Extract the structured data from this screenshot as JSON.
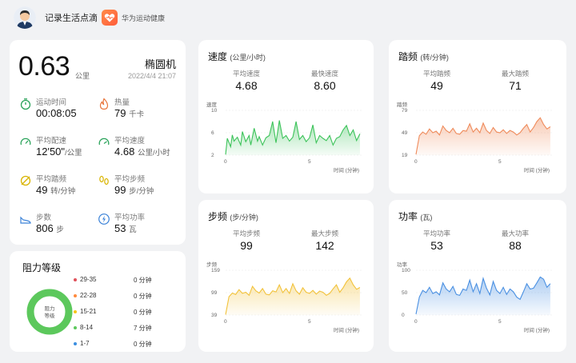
{
  "header": {
    "title": "记录生活点滴",
    "app_name": "华为运动健康"
  },
  "summary": {
    "distance": "0.63",
    "distance_unit": "公里",
    "mode": "椭圆机",
    "datetime": "2022/4/4 21:07",
    "metrics": [
      {
        "label": "运动时间",
        "value": "00:08:05",
        "unit": "",
        "icon": "stopwatch-icon",
        "color": "#2aa35a"
      },
      {
        "label": "热量",
        "value": "79",
        "unit": "千卡",
        "icon": "flame-icon",
        "color": "#e8743b"
      },
      {
        "label": "平均配速",
        "value": "12'50\"",
        "unit": "/公里",
        "icon": "pace-gauge-icon",
        "color": "#2aa35a"
      },
      {
        "label": "平均速度",
        "value": "4.68",
        "unit": "公里/小时",
        "icon": "speed-gauge-icon",
        "color": "#2aa35a"
      },
      {
        "label": "平均踏频",
        "value": "49",
        "unit": "转/分钟",
        "icon": "cadence-icon",
        "color": "#d9b400"
      },
      {
        "label": "平均步频",
        "value": "99",
        "unit": "步/分钟",
        "icon": "footprints-icon",
        "color": "#d9b400"
      },
      {
        "label": "步数",
        "value": "806",
        "unit": "步",
        "icon": "shoe-icon",
        "color": "#3b82d8"
      },
      {
        "label": "平均功率",
        "value": "53",
        "unit": "瓦",
        "icon": "power-bolt-icon",
        "color": "#3b82d8"
      }
    ]
  },
  "resistance": {
    "title": "阻力等级",
    "center_label_1": "阻力",
    "center_label_2": "等级",
    "rows": [
      {
        "range": "29-35",
        "duration": "0 分钟",
        "color": "#e0505a"
      },
      {
        "range": "22-28",
        "duration": "0 分钟",
        "color": "#ff8a3d"
      },
      {
        "range": "15-21",
        "duration": "0 分钟",
        "color": "#f5c518"
      },
      {
        "range": "8-14",
        "duration": "7 分钟",
        "color": "#5cc85c"
      },
      {
        "range": "1-7",
        "duration": "0 分钟",
        "color": "#3b8fe0"
      }
    ]
  },
  "speed_card": {
    "title": "速度",
    "unit": "(公里/小时)",
    "stat1_label": "平均速度",
    "stat1_value": "4.68",
    "stat2_label": "最快速度",
    "stat2_value": "8.60",
    "axis_title": "速度",
    "x_title": "时间 (分钟)",
    "yticks": [
      "10",
      "6",
      "2"
    ],
    "xticks": [
      "0",
      "5"
    ]
  },
  "cadence_card": {
    "title": "踏频",
    "unit": "(转/分钟)",
    "stat1_label": "平均踏频",
    "stat1_value": "49",
    "stat2_label": "最大踏频",
    "stat2_value": "71",
    "axis_title": "踏频",
    "x_title": "时间 (分钟)",
    "yticks": [
      "79",
      "49",
      "19"
    ],
    "xticks": [
      "0",
      "5"
    ]
  },
  "step_card": {
    "title": "步频",
    "unit": "(步/分钟)",
    "stat1_label": "平均步频",
    "stat1_value": "99",
    "stat2_label": "最大步频",
    "stat2_value": "142",
    "axis_title": "步频",
    "x_title": "时间 (分钟)",
    "yticks": [
      "159",
      "99",
      "39"
    ],
    "xticks": [
      "0",
      "5"
    ]
  },
  "power_card": {
    "title": "功率",
    "unit": "(瓦)",
    "stat1_label": "平均功率",
    "stat1_value": "53",
    "stat2_label": "最大功率",
    "stat2_value": "88",
    "axis_title": "功率",
    "x_title": "时间 (分钟)",
    "yticks": [
      "100",
      "50",
      "0"
    ],
    "xticks": [
      "0",
      "5"
    ]
  },
  "chart_data": [
    {
      "type": "area",
      "name": "speed",
      "color": "#3cc35a",
      "ylim": [
        2,
        10
      ],
      "xlim": [
        0,
        8.1
      ],
      "x": [
        0,
        0.1,
        0.3,
        0.4,
        0.5,
        0.7,
        0.9,
        1.0,
        1.2,
        1.4,
        1.5,
        1.7,
        1.9,
        2.0,
        2.2,
        2.4,
        2.6,
        2.8,
        3.0,
        3.2,
        3.4,
        3.6,
        3.8,
        4.0,
        4.2,
        4.4,
        4.6,
        4.8,
        5.0,
        5.2,
        5.4,
        5.6,
        5.8,
        6.0,
        6.2,
        6.4,
        6.6,
        6.8,
        7.0,
        7.2,
        7.4,
        7.6,
        7.8,
        8.0
      ],
      "y": [
        2.1,
        5,
        3.5,
        5.6,
        4.5,
        5.2,
        3.8,
        6.2,
        4.4,
        5.5,
        3.8,
        6.8,
        4.5,
        5.3,
        3.8,
        5.1,
        5.5,
        8.0,
        4.2,
        8.2,
        5.0,
        5.5,
        4.5,
        5.2,
        8.0,
        4.8,
        5.5,
        4.4,
        5.1,
        7.4,
        4.2,
        5.5,
        5.0,
        4.6,
        5.5,
        3.8,
        5.0,
        5.3,
        6.5,
        7.3,
        5.5,
        6.5,
        4.6,
        5.8
      ]
    },
    {
      "type": "area",
      "name": "cadence",
      "color": "#ef8a5a",
      "ylim": [
        19,
        79
      ],
      "xlim": [
        0,
        8.1
      ],
      "x": [
        0,
        0.2,
        0.4,
        0.6,
        0.8,
        1.0,
        1.2,
        1.4,
        1.6,
        1.8,
        2.0,
        2.2,
        2.4,
        2.6,
        2.8,
        3.0,
        3.2,
        3.4,
        3.6,
        3.8,
        4.0,
        4.2,
        4.4,
        4.6,
        4.8,
        5.0,
        5.2,
        5.4,
        5.6,
        5.8,
        6.0,
        6.2,
        6.4,
        6.6,
        6.8,
        7.0,
        7.2,
        7.4,
        7.6,
        7.8,
        8.0
      ],
      "y": [
        20,
        45,
        50,
        47,
        54,
        49,
        51,
        46,
        58,
        52,
        49,
        55,
        48,
        47,
        52,
        51,
        61,
        50,
        55,
        49,
        62,
        52,
        48,
        56,
        50,
        49,
        53,
        48,
        52,
        50,
        46,
        49,
        55,
        60,
        50,
        56,
        64,
        69,
        60,
        54,
        57
      ]
    },
    {
      "type": "area",
      "name": "step_frequency",
      "color": "#f2c23a",
      "ylim": [
        39,
        159
      ],
      "xlim": [
        0,
        8.1
      ],
      "x": [
        0,
        0.2,
        0.4,
        0.6,
        0.8,
        1.0,
        1.2,
        1.4,
        1.6,
        1.8,
        2.0,
        2.2,
        2.4,
        2.6,
        2.8,
        3.0,
        3.2,
        3.4,
        3.6,
        3.8,
        4.0,
        4.2,
        4.4,
        4.6,
        4.8,
        5.0,
        5.2,
        5.4,
        5.6,
        5.8,
        6.0,
        6.2,
        6.4,
        6.6,
        6.8,
        7.0,
        7.2,
        7.4,
        7.6,
        7.8,
        8.0
      ],
      "y": [
        40,
        88,
        98,
        94,
        107,
        97,
        100,
        92,
        116,
        104,
        98,
        110,
        95,
        93,
        104,
        101,
        120,
        99,
        110,
        97,
        123,
        104,
        95,
        112,
        100,
        97,
        105,
        95,
        103,
        100,
        92,
        97,
        109,
        120,
        100,
        112,
        128,
        138,
        120,
        108,
        113
      ]
    },
    {
      "type": "area",
      "name": "power",
      "color": "#4a90e2",
      "ylim": [
        0,
        100
      ],
      "xlim": [
        0,
        8.1
      ],
      "x": [
        0,
        0.2,
        0.4,
        0.6,
        0.8,
        1.0,
        1.2,
        1.4,
        1.6,
        1.8,
        2.0,
        2.2,
        2.4,
        2.6,
        2.8,
        3.0,
        3.2,
        3.4,
        3.6,
        3.8,
        4.0,
        4.2,
        4.4,
        4.6,
        4.8,
        5.0,
        5.2,
        5.4,
        5.6,
        5.8,
        6.0,
        6.2,
        6.4,
        6.6,
        6.8,
        7.0,
        7.2,
        7.4,
        7.6,
        7.8,
        8.0
      ],
      "y": [
        2,
        40,
        55,
        50,
        62,
        48,
        52,
        45,
        72,
        58,
        52,
        64,
        46,
        44,
        58,
        55,
        78,
        52,
        70,
        48,
        82,
        60,
        45,
        75,
        55,
        48,
        62,
        46,
        58,
        52,
        40,
        35,
        52,
        70,
        58,
        60,
        72,
        85,
        80,
        62,
        70
      ]
    }
  ]
}
